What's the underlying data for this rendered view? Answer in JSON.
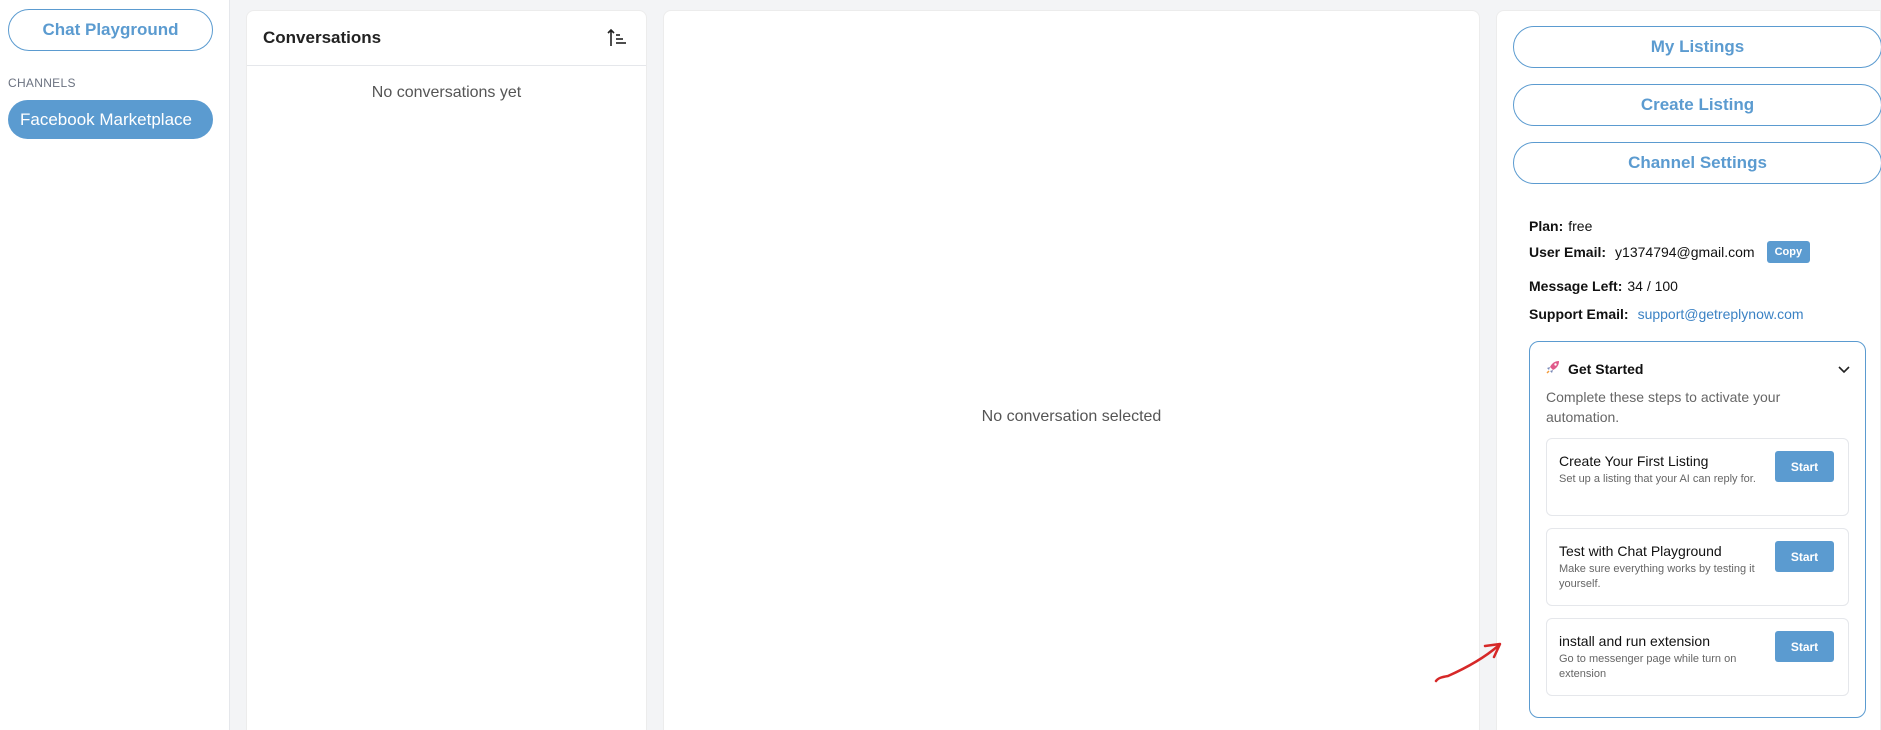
{
  "sidebar": {
    "chat_playground": "Chat Playground",
    "channels_label": "CHANNELS",
    "channels": [
      {
        "label": "Facebook Marketplace"
      }
    ]
  },
  "conversations": {
    "title": "Conversations",
    "empty_text": "No conversations yet"
  },
  "main": {
    "empty_text": "No conversation selected"
  },
  "right": {
    "buttons": {
      "my_listings": "My Listings",
      "create_listing": "Create Listing",
      "channel_settings": "Channel Settings"
    },
    "plan_label": "Plan:",
    "plan_value": "free",
    "email_label": "User Email:",
    "email_value": "y1374794@gmail.com",
    "copy_label": "Copy",
    "messages_label": "Message Left:",
    "messages_value": "34 / 100",
    "support_label": "Support Email:",
    "support_value": "support@getreplynow.com"
  },
  "get_started": {
    "title": "Get Started",
    "description": "Complete these steps to activate your automation.",
    "steps": [
      {
        "title": "Create Your First Listing",
        "description": "Set up a listing that your AI can reply for.",
        "button": "Start"
      },
      {
        "title": "Test with Chat Playground",
        "description": "Make sure everything works by testing it yourself.",
        "button": "Start"
      },
      {
        "title": "install and run extension",
        "description": "Go to messenger page while turn on extension",
        "button": "Start"
      }
    ]
  },
  "colors": {
    "accent": "#5b9bd0",
    "annotation": "#d62828"
  }
}
